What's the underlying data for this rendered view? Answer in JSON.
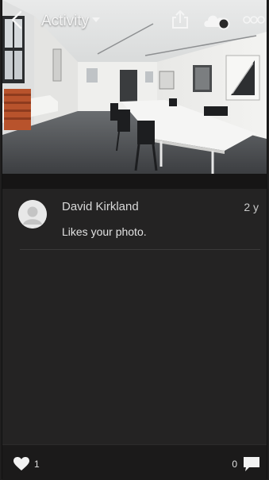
{
  "header": {
    "title": "Activity",
    "icons": [
      "back-icon",
      "chevron-down-icon",
      "share-icon",
      "cloud-sync-icon",
      "more-icon"
    ]
  },
  "activity": [
    {
      "user": "David Kirkland",
      "age": "2 y",
      "message": "Likes your photo."
    }
  ],
  "footer": {
    "likes": "1",
    "comments": "0"
  },
  "colors": {
    "background": "#242323",
    "bar": "#1b1a1a",
    "text": "#d8d8d8"
  }
}
